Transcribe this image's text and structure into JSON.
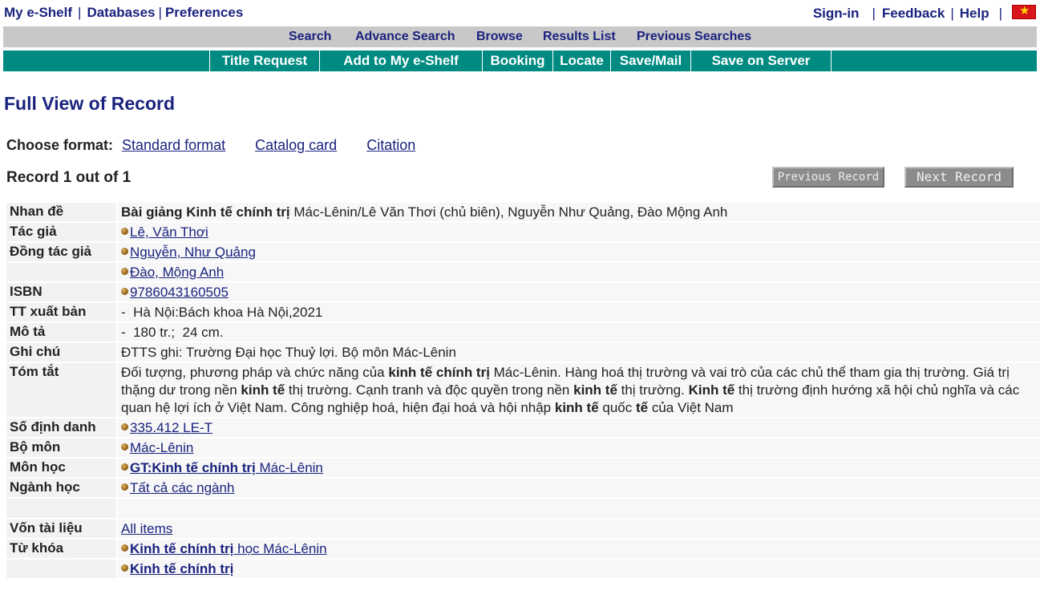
{
  "top_nav": {
    "left": [
      "My e-Shelf",
      "Databases",
      "Preferences"
    ],
    "right": [
      "Sign-in",
      "Feedback",
      "Help"
    ],
    "flag_icon": "vietnam-flag-icon"
  },
  "main_nav": [
    "Search",
    "Advance Search",
    "Browse",
    "Results List",
    "Previous Searches"
  ],
  "action_bar": [
    "Title Request",
    "Add to My e-Shelf",
    "Booking",
    "Locate",
    "Save/Mail",
    "Save on Server"
  ],
  "page_title": "Full View of Record",
  "format": {
    "label": "Choose format:",
    "options": [
      "Standard format",
      "Catalog card",
      "Citation"
    ]
  },
  "record_count": "Record 1 out of 1",
  "buttons": {
    "previous": "Previous Record",
    "next": "Next Record"
  },
  "record": {
    "title_label": "Nhan đề",
    "title_bold": "Bài giảng Kinh tế chính trị",
    "title_rest": " Mác-Lênin/Lê Văn Thơi (chủ biên), Nguyễn Như Quảng, Đào Mộng Anh",
    "author_label": "Tác giả",
    "author": "Lê, Văn Thơi",
    "coauthor_label": "Đồng tác giả",
    "coauthors": [
      "Nguyễn, Như Quảng",
      "Đào, Mộng Anh"
    ],
    "isbn_label": "ISBN",
    "isbn": "9786043160505",
    "pub_label": "TT xuất bản",
    "pub": "-  Hà Nội:Bách khoa Hà Nội,2021",
    "desc_label": "Mô tả",
    "desc": "-  180 tr.;  24 cm.",
    "note_label": "Ghi chú",
    "note": "ĐTTS ghi: Trường Đại học Thuỷ lợi. Bộ môn Mác-Lênin",
    "summary_label": "Tóm tắt",
    "summary_l1_a": "Đối tượng, phương pháp và chức năng của ",
    "summary_l1_b": "kinh tế chính trị",
    "summary_l1_c": " Mác-Lênin. Hàng hoá thị trường và vai trò của các chủ thể tham gia thị trường. Giá trị",
    "summary_l2_a": "thặng dư trong nền ",
    "summary_l2_b": "kinh tế",
    "summary_l2_c": " thị trường. Cạnh tranh và độc quyền trong nền ",
    "summary_l2_d": "kinh tế",
    "summary_l2_e": " thị trường. ",
    "summary_l2_f": "Kinh tế",
    "summary_l2_g": " thị trường định hướng xã hội chủ nghĩa và các",
    "summary_l3_a": "quan hệ lợi ích ở Việt Nam. Công nghiệp hoá, hiện đại hoá và hội nhập ",
    "summary_l3_b": "kinh tế",
    "summary_l3_c": " quốc ",
    "summary_l3_d": "tế",
    "summary_l3_e": " của Việt Nam",
    "callno_label": "Số định danh",
    "callno": "335.412 LE-T",
    "dept_label": "Bộ môn",
    "dept": "Mác-Lênin",
    "course_label": "Môn học",
    "course_bold": "GT:Kinh tế chính trị",
    "course_rest": " Mác-Lênin",
    "major_label": "Ngành học",
    "major": "Tất cả các ngành",
    "holdings_label": "Vốn tài liệu",
    "holdings": "All items",
    "keywords_label": "Từ khóa",
    "kw1_bold": "Kinh tế chính trị",
    "kw1_rest": " học Mác-Lênin",
    "kw2_bold": "Kinh tế chính trị"
  }
}
